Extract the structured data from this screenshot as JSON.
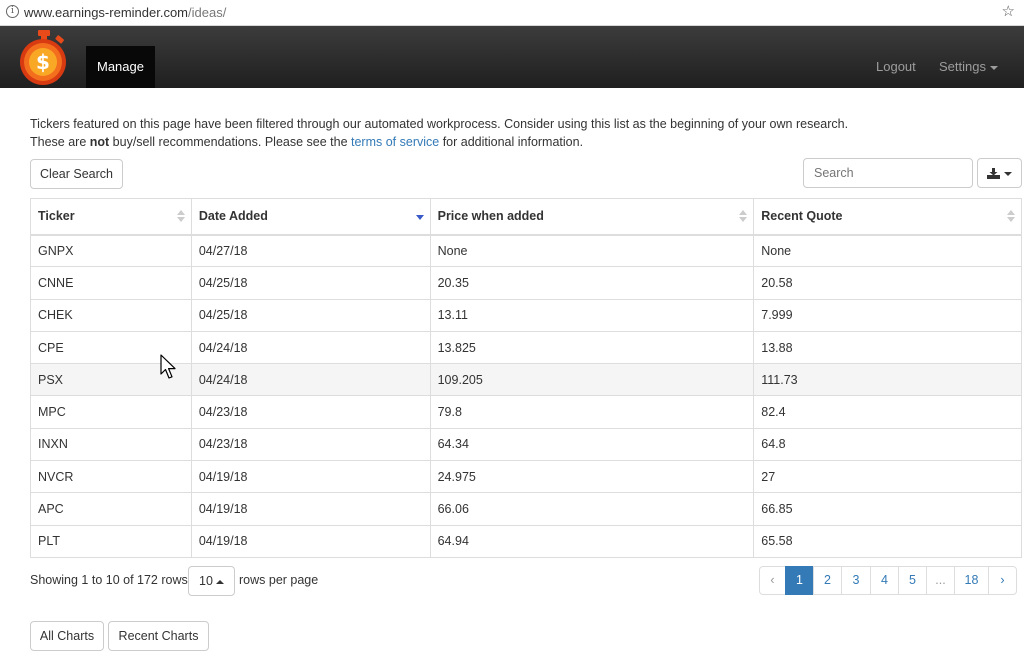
{
  "browser": {
    "url_host": "www.earnings-reminder.com",
    "url_path": "/ideas/"
  },
  "nav": {
    "manage": "Manage",
    "logout": "Logout",
    "settings": "Settings"
  },
  "intro": {
    "line1": "Tickers featured on this page have been filtered through our automated workprocess. Consider using this list as the beginning of your own research.",
    "line2_pre": "These are ",
    "line2_bold": "not",
    "line2_mid": " buy/sell recommendations. Please see the ",
    "line2_link": "terms of service",
    "line2_post": " for additional information."
  },
  "toolbar": {
    "clear": "Clear Search",
    "search_placeholder": "Search"
  },
  "table": {
    "headers": [
      "Ticker",
      "Date Added",
      "Price when added",
      "Recent Quote"
    ],
    "rows": [
      [
        "GNPX",
        "04/27/18",
        "None",
        "None"
      ],
      [
        "CNNE",
        "04/25/18",
        "20.35",
        "20.58"
      ],
      [
        "CHEK",
        "04/25/18",
        "13.11",
        "7.999"
      ],
      [
        "CPE",
        "04/24/18",
        "13.825",
        "13.88"
      ],
      [
        "PSX",
        "04/24/18",
        "109.205",
        "111.73"
      ],
      [
        "MPC",
        "04/23/18",
        "79.8",
        "82.4"
      ],
      [
        "INXN",
        "04/23/18",
        "64.34",
        "64.8"
      ],
      [
        "NVCR",
        "04/19/18",
        "24.975",
        "27"
      ],
      [
        "APC",
        "04/19/18",
        "66.06",
        "66.85"
      ],
      [
        "PLT",
        "04/19/18",
        "64.94",
        "65.58"
      ]
    ]
  },
  "footer": {
    "showing": "Showing 1 to 10 of 172 rows",
    "page_size": "10",
    "rows_per_page": "rows per page",
    "pages": [
      "‹",
      "1",
      "2",
      "3",
      "4",
      "5",
      "...",
      "18",
      "›"
    ]
  },
  "bottom": {
    "all_charts": "All Charts",
    "recent_charts": "Recent Charts"
  },
  "colors": {
    "link": "#337ab7",
    "navbar": "#222222",
    "active_sort": "#3a5ac8"
  }
}
